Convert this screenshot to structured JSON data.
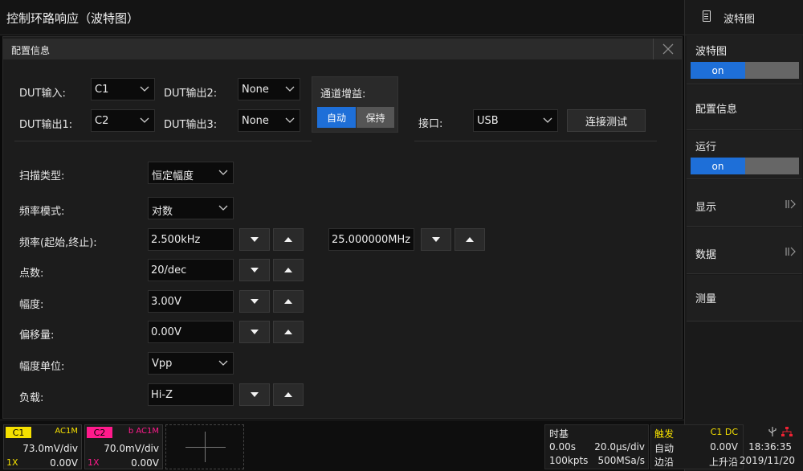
{
  "title": "控制环路响应（波特图）",
  "panel": {
    "header": "配置信息",
    "dut_input_label": "DUT输入:",
    "dut_input_value": "C1",
    "dut_output1_label": "DUT输出1:",
    "dut_output1_value": "C2",
    "dut_output2_label": "DUT输出2:",
    "dut_output2_value": "None",
    "dut_output3_label": "DUT输出3:",
    "dut_output3_value": "None",
    "gain_label": "通道增益:",
    "gain_auto": "自动",
    "gain_hold": "保持",
    "interface_label": "接口:",
    "interface_value": "USB",
    "connect_label": "连接测试",
    "sweep_type_label": "扫描类型:",
    "sweep_type_value": "恒定幅度",
    "freq_mode_label": "频率模式:",
    "freq_mode_value": "对数",
    "freq_label": "频率(起始,终止):",
    "freq_start": "2.500kHz",
    "freq_stop": "25.000000MHz",
    "points_label": "点数:",
    "points_value": "20/dec",
    "amplitude_label": "幅度:",
    "amplitude_value": "3.00V",
    "offset_label": "偏移量:",
    "offset_value": "0.00V",
    "amp_unit_label": "幅度单位:",
    "amp_unit_value": "Vpp",
    "load_label": "负载:",
    "load_value": "Hi-Z"
  },
  "sidemenu": {
    "head": "波特图",
    "bode_label": "波特图",
    "bode_toggle": "on",
    "config_label": "配置信息",
    "run_label": "运行",
    "run_toggle": "on",
    "display_label": "显示",
    "data_label": "数据",
    "measure_label": "测量"
  },
  "status": {
    "ch1": {
      "tag": "C1",
      "coupling": "AC1M",
      "vdiv": "73.0mV/div",
      "probe": "1X",
      "offset": "0.00V",
      "color": "#f5e000"
    },
    "ch2": {
      "tag": "C2",
      "coupling": "b AC1M",
      "vdiv": "70.0mV/div",
      "probe": "1X",
      "offset": "0.00V",
      "color": "#ff1a8c"
    },
    "timebase": {
      "label": "时基",
      "delay": "0.00s",
      "tdiv": "20.0μs/div",
      "mem": "100kpts",
      "rate": "500MSa/s"
    },
    "trigger": {
      "label": "触发",
      "source": "C1 DC",
      "mode": "自动",
      "level": "0.00V",
      "type": "边沿",
      "slope": "上升沿"
    },
    "time": "18:36:35",
    "date": "2019/11/20"
  }
}
